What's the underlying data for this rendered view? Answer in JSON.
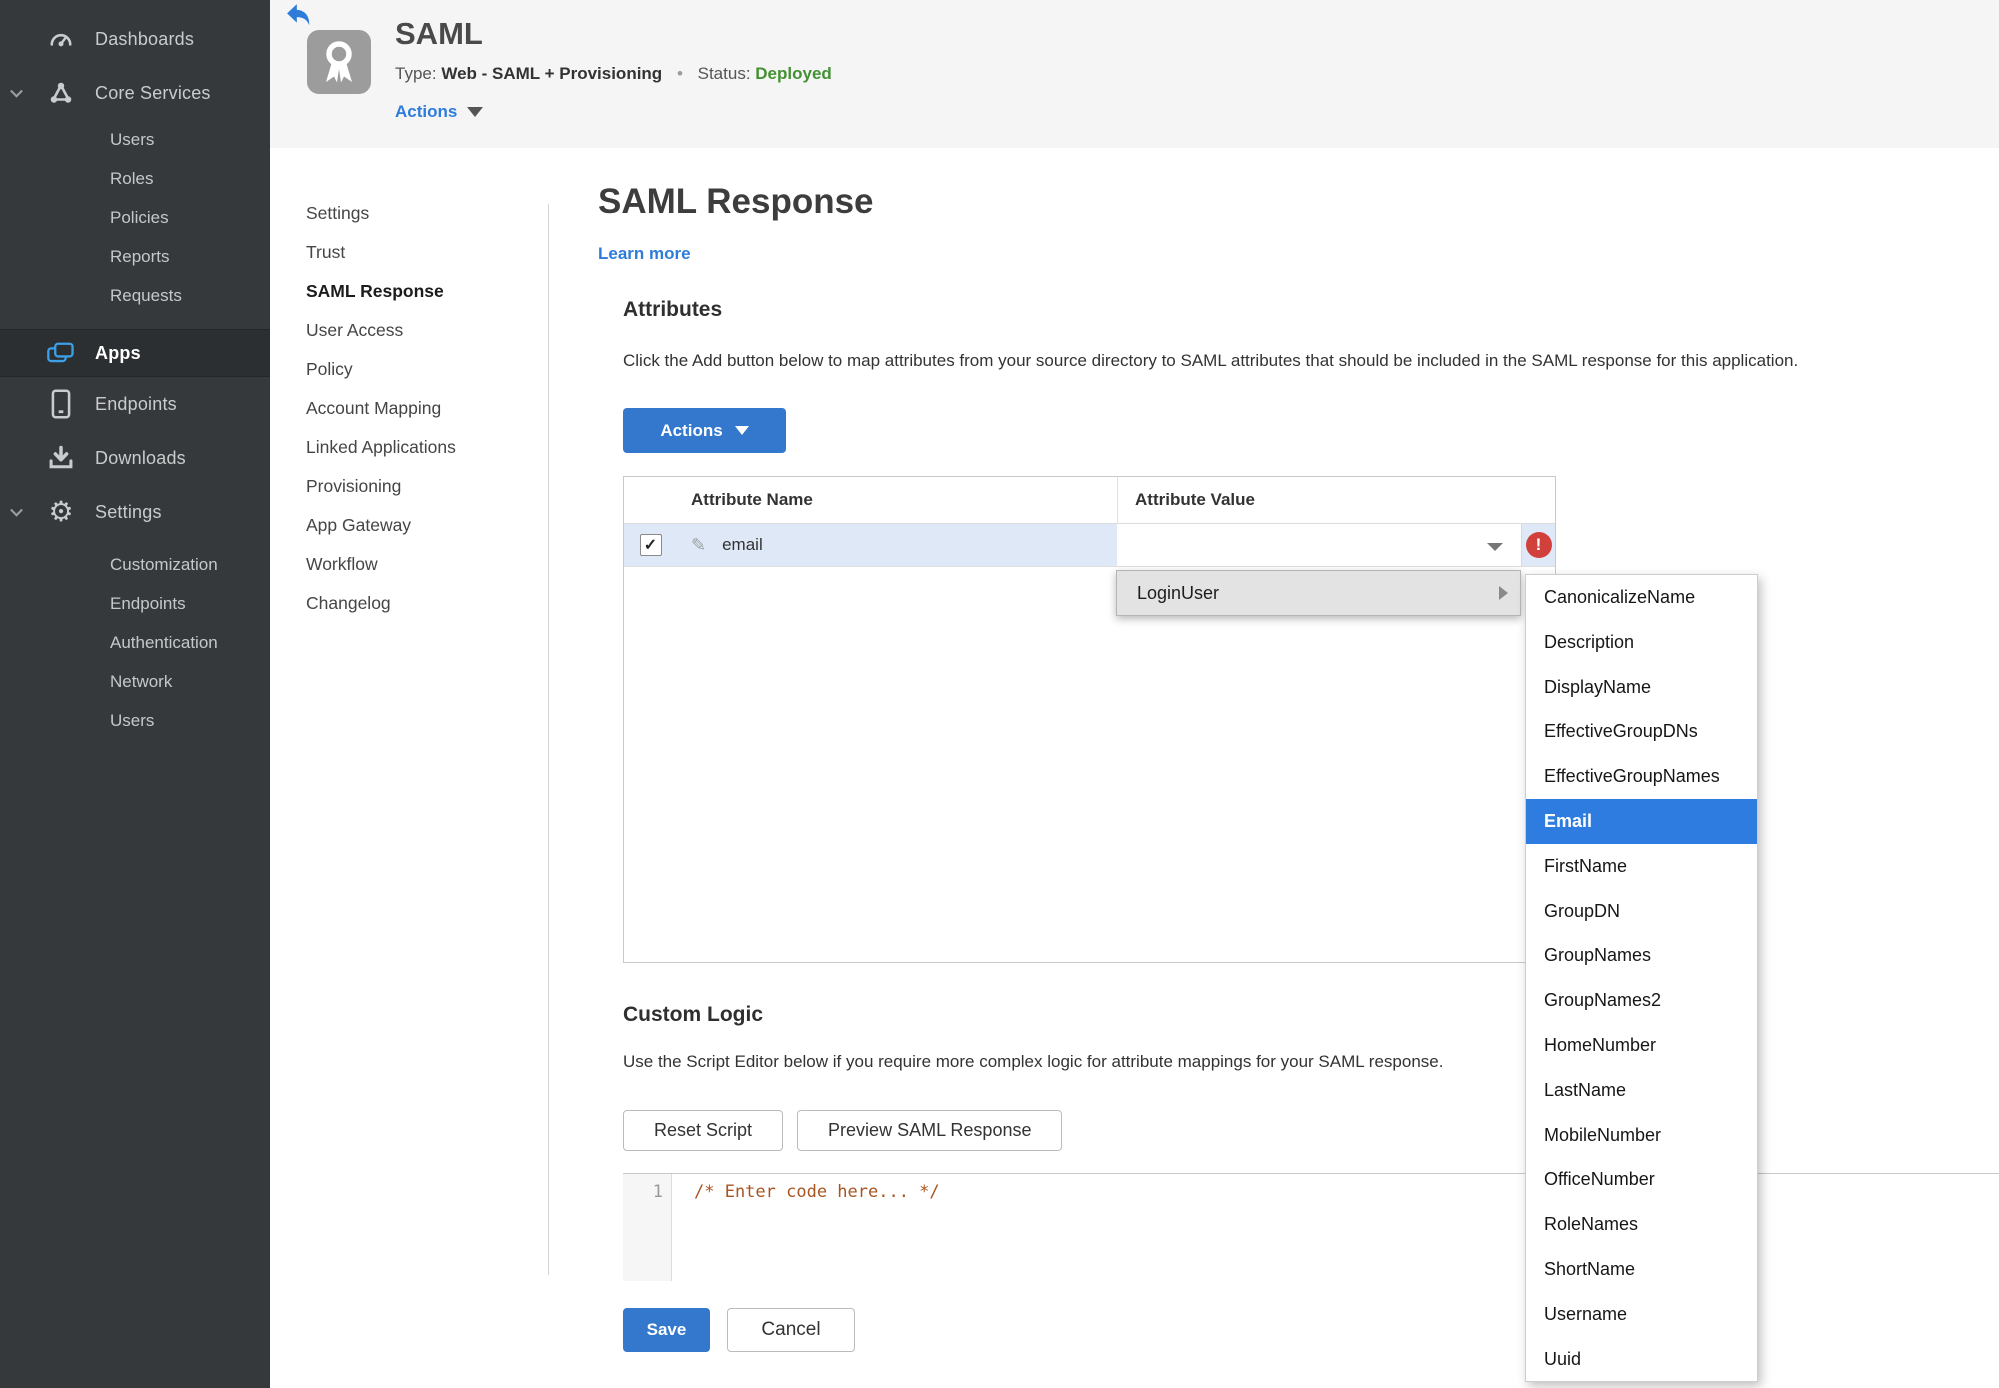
{
  "sidebar": {
    "dashboards": "Dashboards",
    "core_services": "Core Services",
    "core_items": [
      "Users",
      "Roles",
      "Policies",
      "Reports",
      "Requests"
    ],
    "apps": "Apps",
    "endpoints": "Endpoints",
    "downloads": "Downloads",
    "settings": "Settings",
    "settings_items": [
      "Customization",
      "Endpoints",
      "Authentication",
      "Network",
      "Users"
    ]
  },
  "app_header": {
    "title": "SAML",
    "type_label": "Type:",
    "type_value": "Web - SAML + Provisioning",
    "separator": "•",
    "status_label": "Status:",
    "status_value": "Deployed",
    "actions_label": "Actions"
  },
  "subnav": {
    "items": [
      "Settings",
      "Trust",
      "SAML Response",
      "User Access",
      "Policy",
      "Account Mapping",
      "Linked Applications",
      "Provisioning",
      "App Gateway",
      "Workflow",
      "Changelog"
    ],
    "active": "SAML Response"
  },
  "main": {
    "title": "SAML Response",
    "learn_more": "Learn more",
    "attributes": {
      "heading": "Attributes",
      "description": "Click the Add button below to map attributes from your source directory to SAML attributes that should be included in the SAML response for this application.",
      "actions_button": "Actions",
      "table": {
        "columns": [
          "Attribute Name",
          "Attribute Value"
        ],
        "rows": [
          {
            "name": "email",
            "value": "",
            "checked": true
          }
        ]
      }
    },
    "custom_logic": {
      "heading": "Custom Logic",
      "description": "Use the Script Editor below if you require more complex logic for attribute mappings for your SAML response.",
      "reset_button": "Reset Script",
      "preview_button": "Preview SAML Response",
      "editor": {
        "line_number": "1",
        "code": "/* Enter code here... */"
      }
    },
    "save_button": "Save",
    "cancel_button": "Cancel"
  },
  "dropdown": {
    "parent_item": "LoginUser",
    "selected": "Email",
    "submenu": [
      "CanonicalizeName",
      "Description",
      "DisplayName",
      "EffectiveGroupDNs",
      "EffectiveGroupNames",
      "Email",
      "FirstName",
      "GroupDN",
      "GroupNames",
      "GroupNames2",
      "HomeNumber",
      "LastName",
      "MobileNumber",
      "OfficeNumber",
      "RoleNames",
      "ShortName",
      "Username",
      "Uuid"
    ]
  },
  "icons": {
    "checkmark": "✓",
    "pencil": "✎",
    "gear": "⚙",
    "error_mark": "!"
  },
  "colors": {
    "accent_blue": "#3478cd",
    "highlight_blue": "#2f7ce0",
    "link_blue": "#2e7cd9",
    "status_green": "#449133",
    "error_red": "#d1403a",
    "sidebar_bg": "#36393c",
    "row_highlight": "#dfe8f6"
  }
}
